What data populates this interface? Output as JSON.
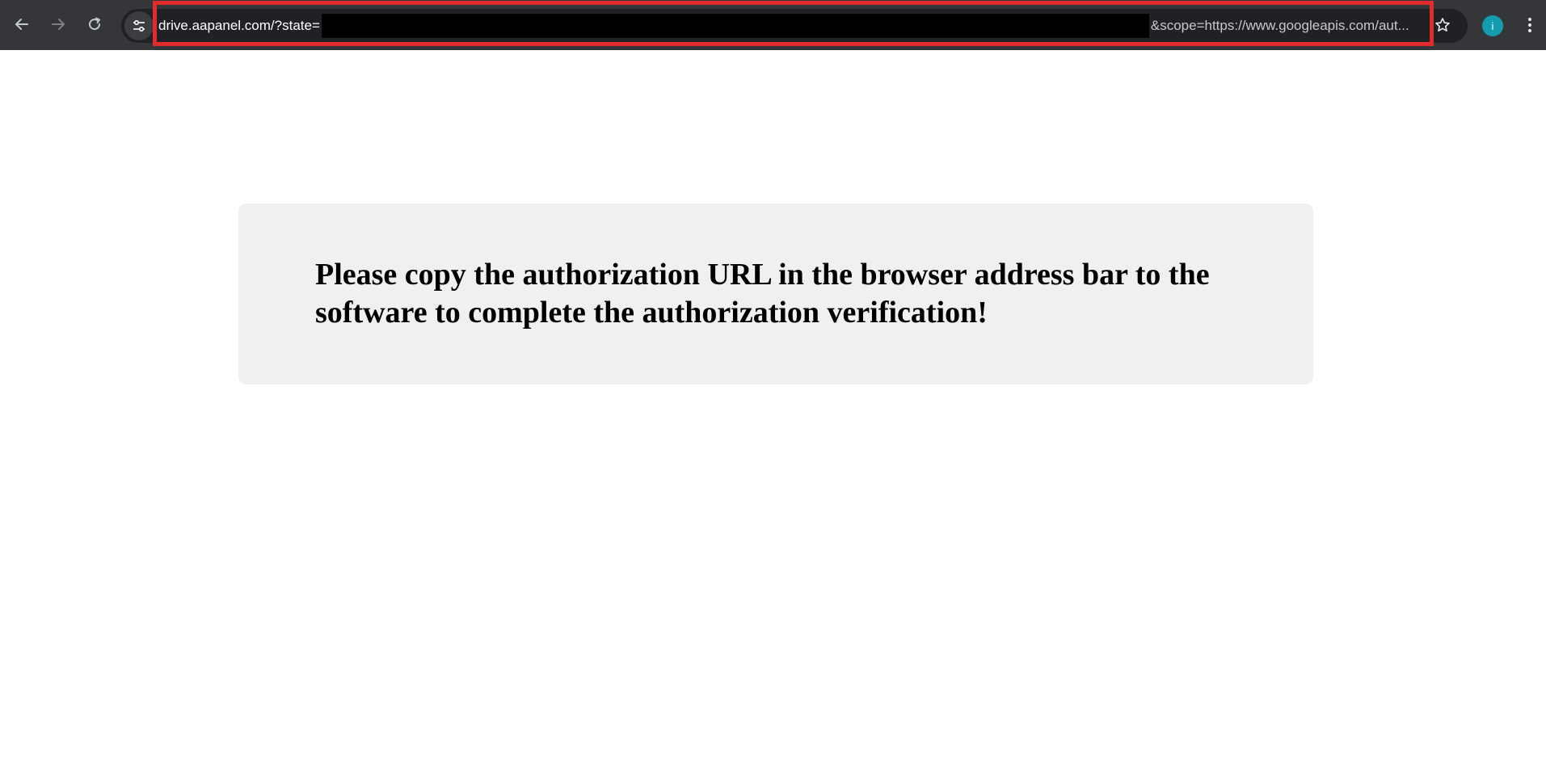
{
  "browser": {
    "address_bar": {
      "url_prefix": "drive.aapanel.com/?state=",
      "url_suffix": "&scope=https://www.googleapis.com/aut..."
    },
    "profile_initial": "i",
    "icons": {
      "back": "arrow-left-icon",
      "forward": "arrow-right-icon",
      "reload": "reload-icon",
      "site_info": "tune-icon",
      "bookmark": "star-icon",
      "menu": "kebab-menu-icon"
    },
    "colors": {
      "toolbar": "#35363a",
      "omnibox": "#202124",
      "highlight": "#e22b2b",
      "avatar": "#129eaf"
    }
  },
  "page": {
    "message": "Please copy the authorization URL in the browser address bar to the software to complete the authorization verification!"
  }
}
